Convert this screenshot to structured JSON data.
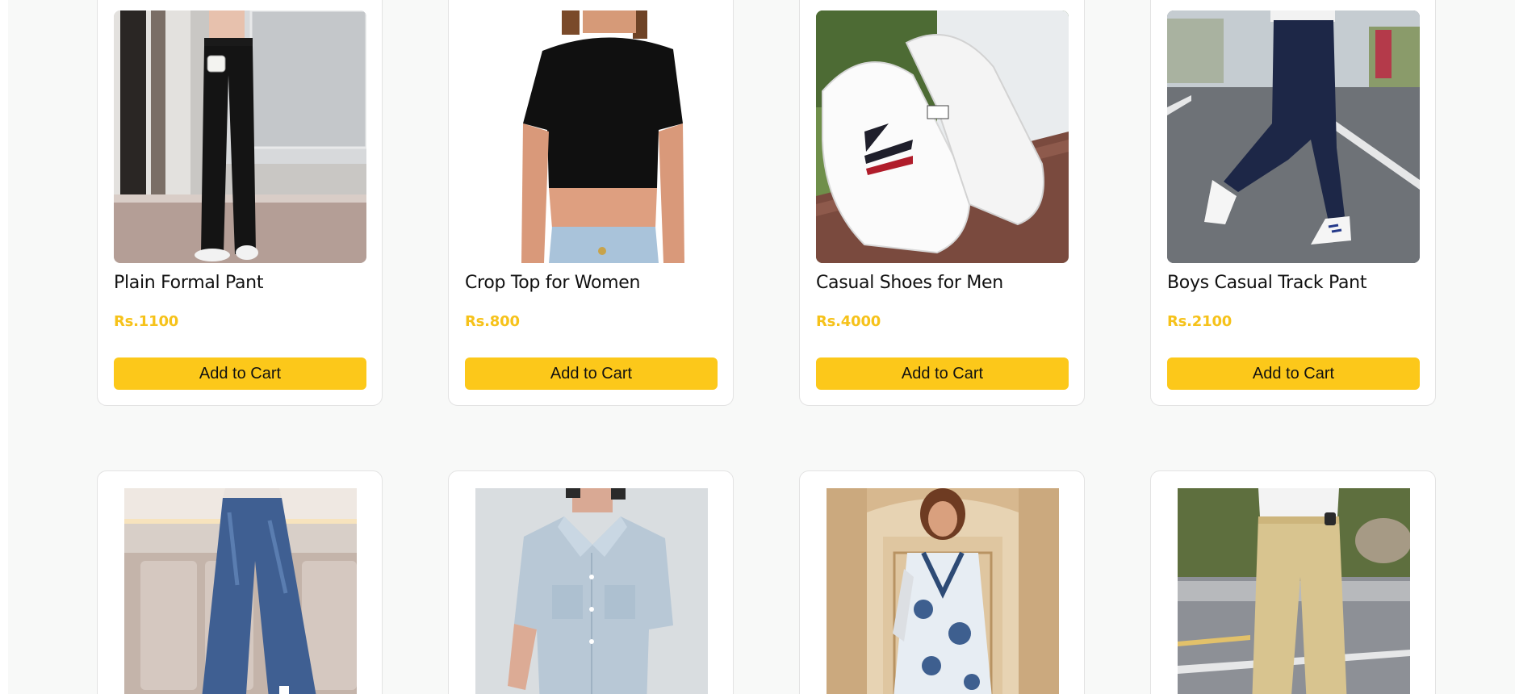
{
  "products": [
    {
      "title": "Plain Formal Pant",
      "price": "Rs.1100",
      "button_label": "Add to Cart",
      "image_icon": "black-formal-pant-image"
    },
    {
      "title": "Crop Top for Women",
      "price": "Rs.800",
      "button_label": "Add to Cart",
      "image_icon": "black-crop-top-image"
    },
    {
      "title": "Casual Shoes for Men",
      "price": "Rs.4000",
      "button_label": "Add to Cart",
      "image_icon": "white-sneakers-image"
    },
    {
      "title": "Boys Casual Track Pant",
      "price": "Rs.2100",
      "button_label": "Add to Cart",
      "image_icon": "navy-track-pant-image"
    },
    {
      "image_icon": "blue-denim-jeans-image"
    },
    {
      "image_icon": "light-blue-shirt-image"
    },
    {
      "image_icon": "floral-kurta-set-image"
    },
    {
      "image_icon": "beige-chino-pant-image"
    }
  ],
  "colors": {
    "accent": "#fcc81a",
    "price": "#f6c21a",
    "page_background": "#f8f9f8",
    "card_border": "#e3e3e3"
  }
}
